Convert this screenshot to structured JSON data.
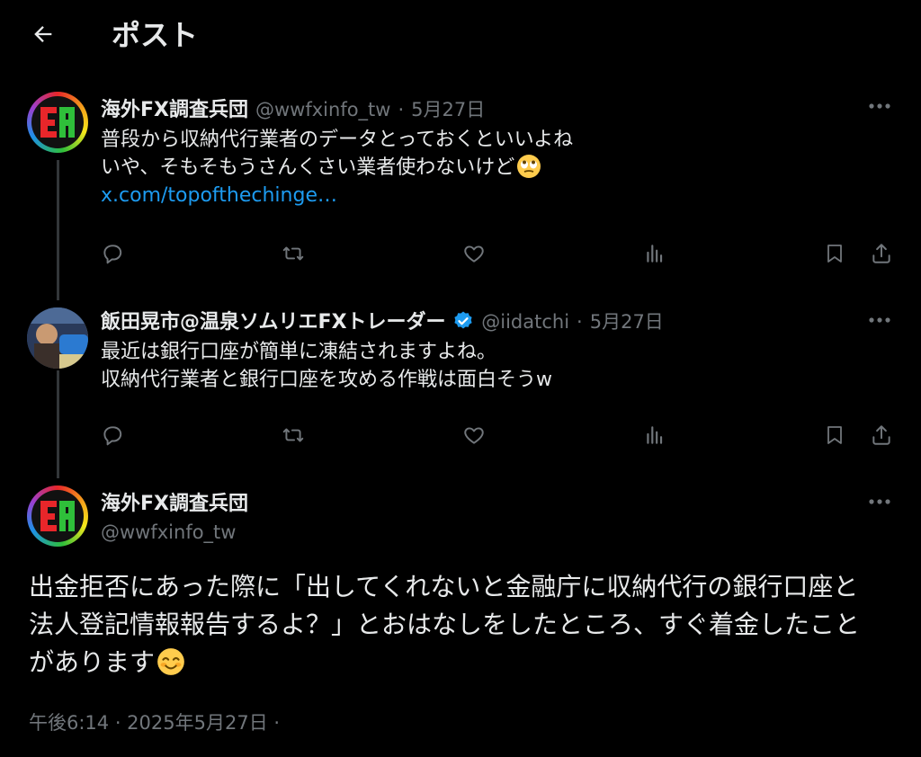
{
  "header": {
    "title": "ポスト",
    "back_icon": "arrow-left-icon"
  },
  "tweets": [
    {
      "name": "海外FX調査兵団",
      "handle": "@wwfxinfo_tw",
      "date": "5月27日",
      "lines": [
        "普段から収納代行業者のデータとっておくといいよね",
        "いや、そもそもうさんくさい業者使わないけど"
      ],
      "emoji": "face-with-rolling-eyes",
      "link": "x.com/topofthechinge…"
    },
    {
      "name": "飯田晃市@温泉ソムリエFXトレーダー",
      "handle": "@iidatchi",
      "date": "5月27日",
      "verified": true,
      "lines": [
        "最近は銀行口座が簡単に凍結されますよね。",
        "収納代行業者と銀行口座を攻める作戦は面白そうw"
      ]
    }
  ],
  "main_post": {
    "name": "海外FX調査兵団",
    "handle": "@wwfxinfo_tw",
    "lines": [
      "出金拒否にあった際に「出してくれないと金融庁に収納代行の銀行口座と",
      "法人登記情報報告するよ？」とおはなしをしたところ、すぐ着金したこと",
      "があります"
    ],
    "emoji": "smiling-face-with-smiling-eyes",
    "timestamp": "午後6:14 · 2025年5月27日 ·"
  },
  "actions": [
    "reply-icon",
    "repost-icon",
    "like-icon",
    "views-icon",
    "bookmark-icon",
    "share-icon"
  ],
  "colors": {
    "background": "#000000",
    "text": "#e7e9ea",
    "secondary": "#71767b",
    "link": "#1d9bf0",
    "verified": "#1d9bf0"
  }
}
